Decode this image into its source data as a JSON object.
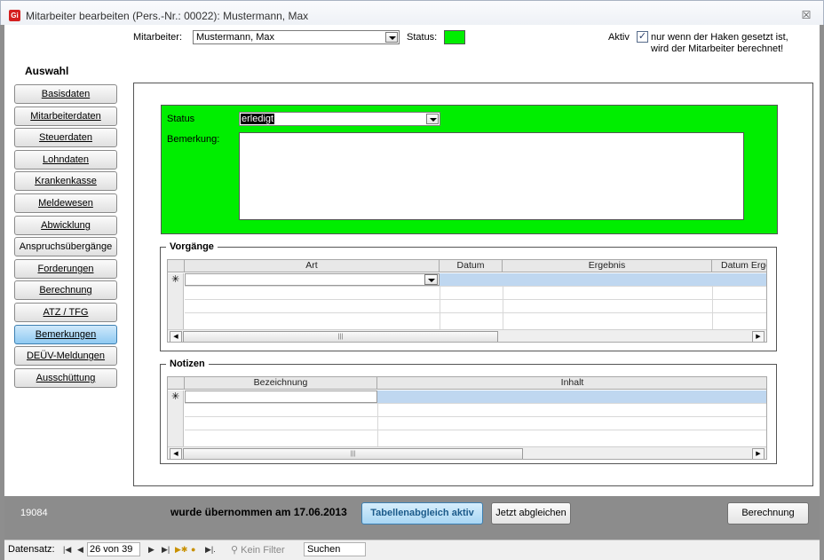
{
  "window": {
    "title": "Mitarbeiter bearbeiten (Pers.-Nr.: 00022): Mustermann, Max",
    "app_icon": "Gi",
    "close_glyph": "☒"
  },
  "header": {
    "mitarbeiter_label": "Mitarbeiter:",
    "mitarbeiter_value": "Mustermann, Max",
    "status_label": "Status:",
    "status_color": "#00ee00",
    "aktiv_label": "Aktiv",
    "aktiv_checked": true,
    "aktiv_note_line1": "nur wenn der Haken gesetzt ist,",
    "aktiv_note_line2": "wird der Mitarbeiter berechnet!"
  },
  "sidebar": {
    "title": "Auswahl",
    "items": [
      {
        "label": "Basisdaten"
      },
      {
        "label": "Mitarbeiterdaten"
      },
      {
        "label": "Steuerdaten"
      },
      {
        "label": "Lohndaten"
      },
      {
        "label": "Krankenkasse"
      },
      {
        "label": "Meldewesen"
      },
      {
        "label": "Abwicklung"
      },
      {
        "label": "Anspruchsübergänge"
      },
      {
        "label": "Forderungen"
      },
      {
        "label": "Berechnung"
      },
      {
        "label": "ATZ / TFG"
      },
      {
        "label": "Bemerkungen",
        "active": true
      },
      {
        "label": "DEÜV-Meldungen"
      },
      {
        "label": "Ausschüttung"
      }
    ]
  },
  "status_section": {
    "status_label": "Status",
    "status_value": "erledigt",
    "bemerkung_label": "Bemerkung:",
    "bemerkung_value": "",
    "background": "#00ee00"
  },
  "vorgaenge": {
    "title": "Vorgänge",
    "columns": [
      "Art",
      "Datum",
      "Ergebnis",
      "Datum Erge"
    ],
    "new_row_marker": "✳"
  },
  "notizen": {
    "title": "Notizen",
    "columns": [
      "Bezeichnung",
      "Inhalt"
    ],
    "new_row_marker": "✳"
  },
  "footer": {
    "id_value": "19084",
    "uebernommen_text": "wurde übernommen am",
    "uebernommen_date": "17.06.2013",
    "tabellenabgleich_label": "Tabellenabgleich aktiv",
    "jetzt_abgleichen_label": "Jetzt abgleichen",
    "berechnung_label": "Berechnung"
  },
  "record_nav": {
    "label": "Datensatz:",
    "position": "26 von 39",
    "filter_label": "Kein Filter",
    "search_placeholder": "Suchen"
  },
  "colors": {
    "active_nav": "#8fcaf2",
    "accent_green": "#00ee00",
    "footer_gray": "#8c8c8c"
  }
}
